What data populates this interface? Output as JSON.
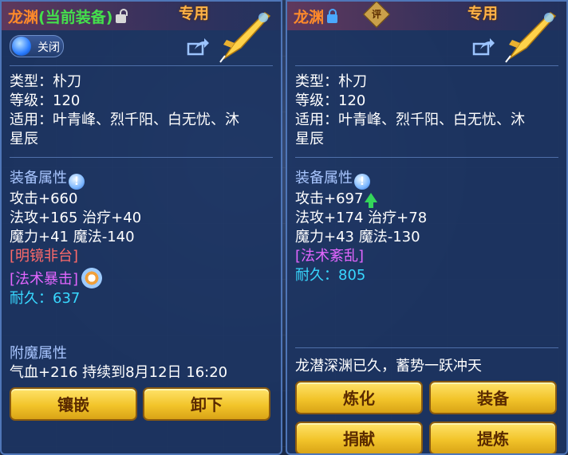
{
  "left": {
    "name": "龙渊",
    "equipped_tag": "(当前装备)",
    "exclusive": "专用",
    "toggle_label": "关闭",
    "type_line": "类型：朴刀",
    "level_line": "等级：120",
    "applies_line1": "适用：叶青峰、烈千阳、白无忧、沐",
    "applies_line2": "星辰",
    "attr_title": "装备属性",
    "attack": "攻击+660",
    "mag_heal": "法攻+165 治疗+40",
    "power_mana": "魔力+41 魔法-140",
    "special1": "[明镜非台]",
    "special2": "[法术暴击]",
    "durability": "耐久：637",
    "enchant_title": "附魔属性",
    "enchant_line": "气血+216 持续到8月12日 16:20",
    "buttons": [
      "镶嵌",
      "卸下"
    ]
  },
  "right": {
    "name": "龙渊",
    "rate_icon_text": "评",
    "exclusive": "专用",
    "type_line": "类型：朴刀",
    "level_line": "等级：120",
    "applies_line1": "适用：叶青峰、烈千阳、白无忧、沐",
    "applies_line2": "星辰",
    "attr_title": "装备属性",
    "attack": "攻击+697",
    "mag_heal": "法攻+174 治疗+78",
    "power_mana": "魔力+43 魔法-130",
    "special1": "[法术紊乱]",
    "durability": "耐久：805",
    "description": "龙潜深渊已久，蓄势一跃冲天",
    "buttons": [
      "炼化",
      "装备",
      "捐献",
      "提炼"
    ]
  },
  "icons": {
    "lock_left": "unlocked-lock-icon",
    "lock_right": "locked-lock-icon",
    "share": "share-icon",
    "weapon": "golden-blade-icon",
    "hint": "info-bubble-icon",
    "swirl": "swirl-effect-icon",
    "arrow": "green-up-arrow-icon"
  },
  "colors": {
    "name": "#ff8a2a",
    "equipped": "#44e04c",
    "special_red": "#ff6a6a",
    "special_purple": "#e266ff",
    "durability": "#38d8ff",
    "button_gold": "#f2c42a"
  }
}
